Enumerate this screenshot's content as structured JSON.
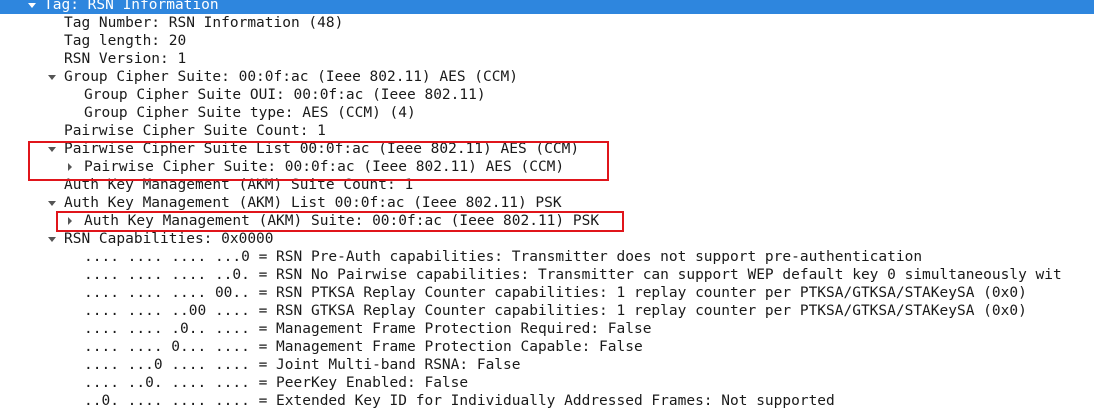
{
  "tree": {
    "tag_header": "Tag: RSN Information",
    "tag_number": "Tag Number: RSN Information (48)",
    "tag_length": "Tag length: 20",
    "rsn_version": "RSN Version: 1",
    "group_cipher_suite": "Group Cipher Suite: 00:0f:ac (Ieee 802.11) AES (CCM)",
    "group_cipher_suite_oui": "Group Cipher Suite OUI: 00:0f:ac (Ieee 802.11)",
    "group_cipher_suite_type": "Group Cipher Suite type: AES (CCM) (4)",
    "pairwise_cipher_suite_count": "Pairwise Cipher Suite Count: 1",
    "pairwise_cipher_suite_list": "Pairwise Cipher Suite List 00:0f:ac (Ieee 802.11) AES (CCM)",
    "pairwise_cipher_suite": "Pairwise Cipher Suite: 00:0f:ac (Ieee 802.11) AES (CCM)",
    "akm_suite_count": "Auth Key Management (AKM) Suite Count: 1",
    "akm_list": "Auth Key Management (AKM) List 00:0f:ac (Ieee 802.11) PSK",
    "akm_suite": "Auth Key Management (AKM) Suite: 00:0f:ac (Ieee 802.11) PSK",
    "rsn_capabilities": "RSN Capabilities: 0x0000",
    "cap_pre_auth": ".... .... .... ...0 = RSN Pre-Auth capabilities: Transmitter does not support pre-authentication",
    "cap_no_pairwise": ".... .... .... ..0. = RSN No Pairwise capabilities: Transmitter can support WEP default key 0 simultaneously wit",
    "cap_ptksa": ".... .... .... 00.. = RSN PTKSA Replay Counter capabilities: 1 replay counter per PTKSA/GTKSA/STAKeySA (0x0)",
    "cap_gtksa": ".... .... ..00 .... = RSN GTKSA Replay Counter capabilities: 1 replay counter per PTKSA/GTKSA/STAKeySA (0x0)",
    "cap_mfp_required": ".... .... .0.. .... = Management Frame Protection Required: False",
    "cap_mfp_capable": ".... .... 0... .... = Management Frame Protection Capable: False",
    "cap_joint_multiband": ".... ...0 .... .... = Joint Multi-band RSNA: False",
    "cap_peerkey": ".... ..0. .... .... = PeerKey Enabled: False",
    "cap_extended_key_id": "..0. .... .... .... = Extended Key ID for Individually Addressed Frames: Not supported"
  },
  "colors": {
    "selection": "#2e86de",
    "highlight_box": "#e0151b"
  }
}
